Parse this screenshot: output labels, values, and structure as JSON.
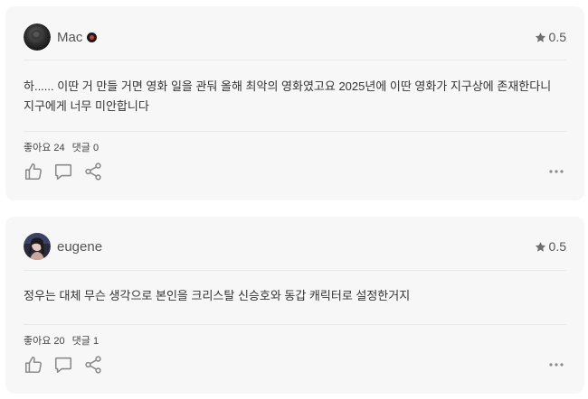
{
  "reviews": [
    {
      "username": "Mac",
      "avatar": "dark-round-avatar",
      "has_badge": true,
      "rating": "0.5",
      "comment": "하...... 이딴 거 만들 거면 영화 일을 관둬 올해 최악의 영화였고요 2025년에 이딴 영화가 지구상에 존재한다니 지구에게 너무 미안합니다",
      "likes_label": "좋아요 24",
      "comments_label": "댓글 0"
    },
    {
      "username": "eugene",
      "avatar": "portrait-avatar",
      "has_badge": false,
      "rating": "0.5",
      "comment": "정우는 대체 무슨 생각으로 본인을 크리스탈 신승호와 동갑 캐릭터로 설정한거지",
      "likes_label": "좋아요 20",
      "comments_label": "댓글 1"
    }
  ],
  "icons": {
    "rating": "star-icon",
    "like": "thumbs-up-icon",
    "comment": "comment-bubble-icon",
    "share": "share-icon",
    "more": "more-dots-icon"
  },
  "colors": {
    "card_background": "#f7f7f7",
    "icon_gray": "#8a8a8a",
    "badge_red": "#e0312b"
  }
}
